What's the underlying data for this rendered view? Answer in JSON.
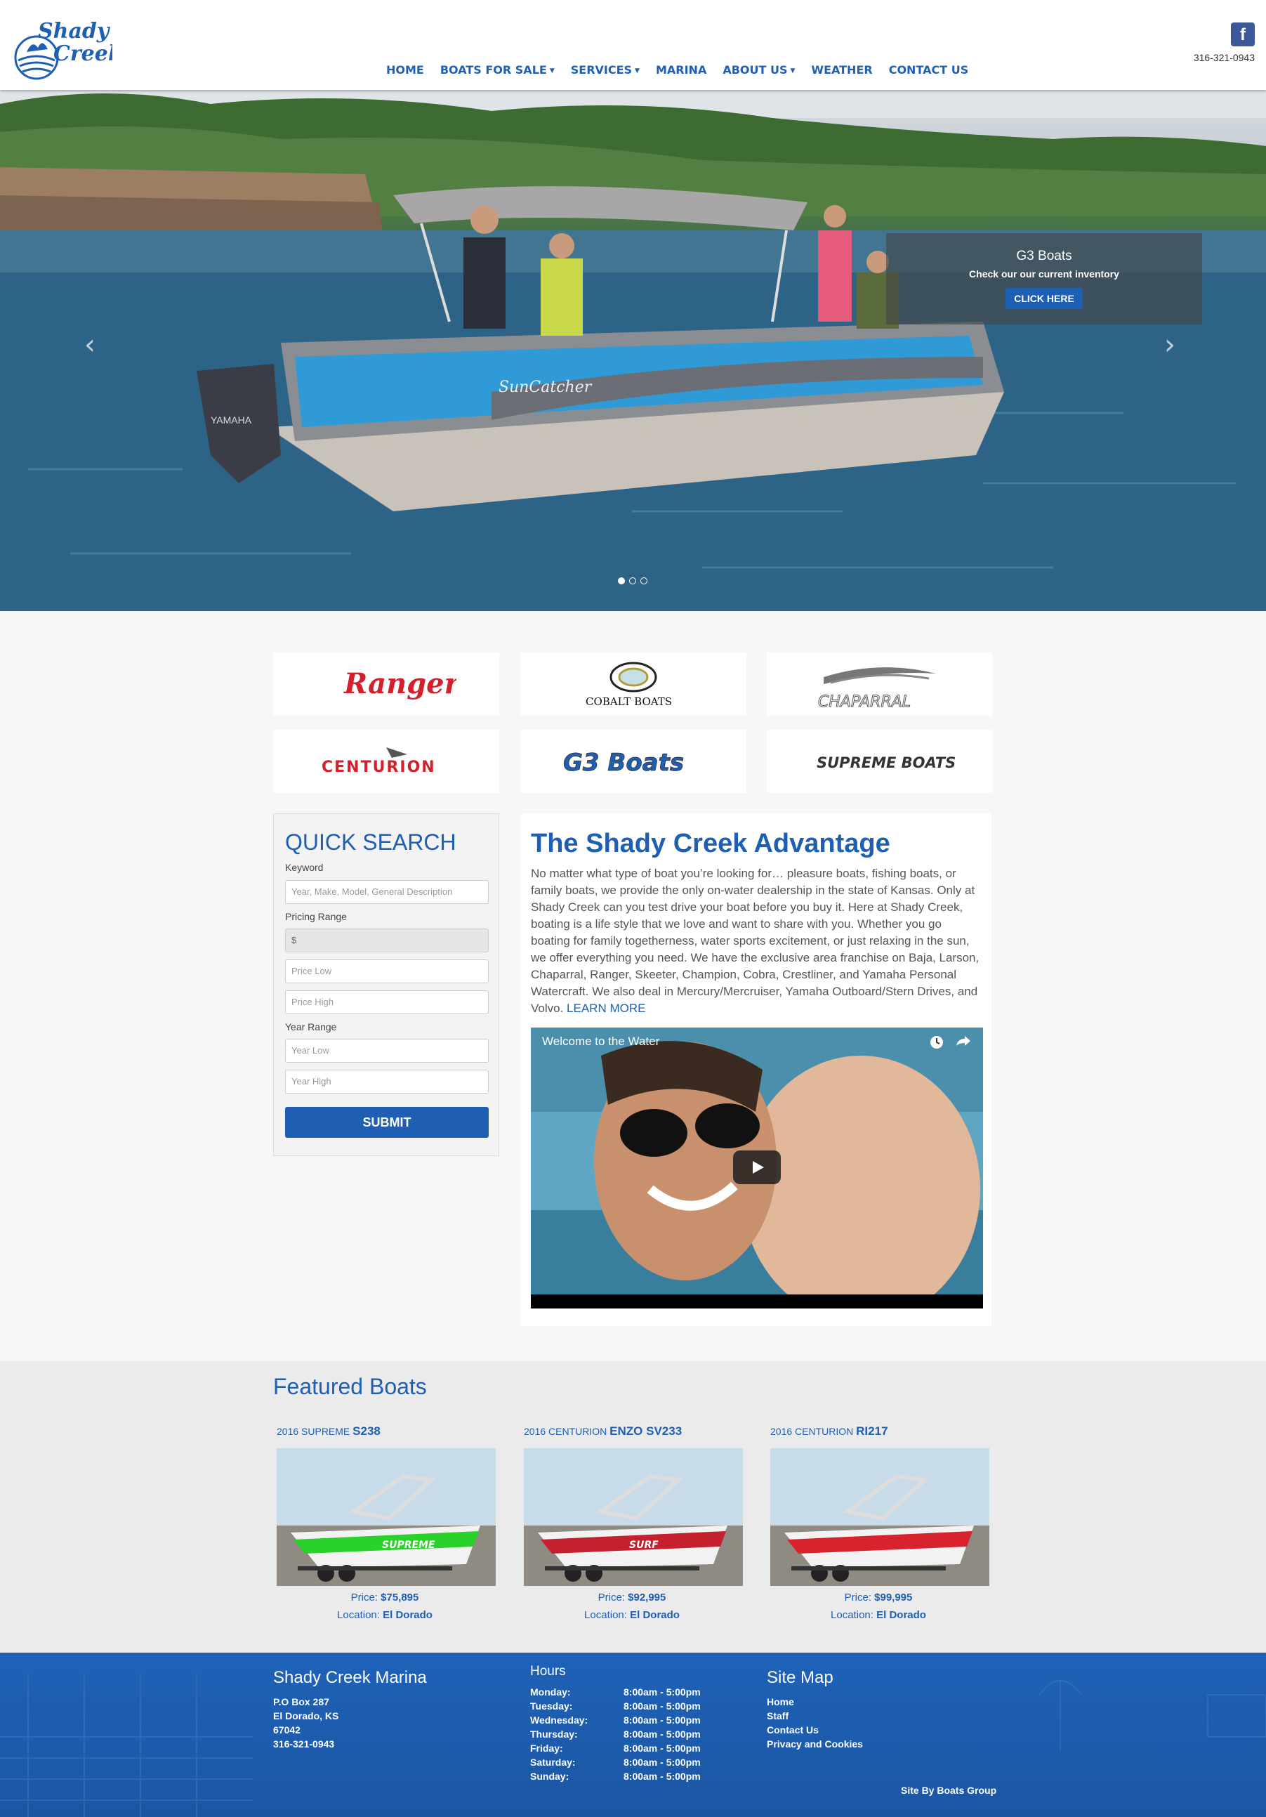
{
  "header": {
    "logo_text_top": "Shady",
    "logo_text_bottom": "Creek",
    "phone": "316-321-0943",
    "facebook_label": "f",
    "nav": [
      {
        "label": "HOME",
        "has_dropdown": false
      },
      {
        "label": "BOATS FOR SALE",
        "has_dropdown": true
      },
      {
        "label": "SERVICES",
        "has_dropdown": true
      },
      {
        "label": "MARINA",
        "has_dropdown": false
      },
      {
        "label": "ABOUT US",
        "has_dropdown": true
      },
      {
        "label": "WEATHER",
        "has_dropdown": false
      },
      {
        "label": "CONTACT US",
        "has_dropdown": false
      }
    ]
  },
  "hero": {
    "caption_title": "G3 Boats",
    "caption_subtitle": "Check our our current inventory",
    "caption_button": "CLICK HERE",
    "boat_name": "SunCatcher",
    "motor_label": "YAMAHA",
    "prev_icon": "‹",
    "next_icon": "›",
    "slides": 3,
    "active_slide": 1
  },
  "brands": [
    "Ranger",
    "COBALT BOATS",
    "CHAPARRAL",
    "CENTURION",
    "G3 Boats",
    "SUPREME BOATS"
  ],
  "quick_search": {
    "title": "QUICK SEARCH",
    "keyword_label": "Keyword",
    "keyword_placeholder": "Year, Make, Model, General Description",
    "pricing_label": "Pricing Range",
    "currency": "$",
    "price_low_placeholder": "Price Low",
    "price_high_placeholder": "Price High",
    "year_label": "Year Range",
    "year_low_placeholder": "Year Low",
    "year_high_placeholder": "Year High",
    "submit_label": "SUBMIT"
  },
  "advantage": {
    "title": "The Shady Creek Advantage",
    "body": "No matter what type of boat you’re looking for… pleasure boats, fishing boats, or family boats, we provide the only on-water dealership in the state of Kansas. Only at Shady Creek can you test drive your boat before you buy it. Here at Shady Creek, boating is a life style that we love and want to share with you. Whether you go boating for family togetherness, water sports excitement, or just relaxing in the sun, we offer everything you need. We have the exclusive area franchise on Baja, Larson, Chaparral, Ranger, Skeeter, Champion, Cobra, Crestliner, and Yamaha Personal Watercraft. We also deal in Mercury/Mercruiser, Yamaha Outboard/Stern Drives, and Volvo.",
    "learn_more": "LEARN MORE",
    "video_title": "Welcome to the Water"
  },
  "featured": {
    "title": "Featured Boats",
    "boats": [
      {
        "prefix": "2016 SUPREME",
        "model": "S238",
        "price_label": "Price:",
        "price": "$75,895",
        "location_label": "Location:",
        "location": "El Dorado",
        "hull": "#2bd12b",
        "decal": "SUPREME"
      },
      {
        "prefix": "2016 CENTURION",
        "model": "ENZO SV233",
        "price_label": "Price:",
        "price": "$92,995",
        "location_label": "Location:",
        "location": "El Dorado",
        "hull": "#c4202e",
        "decal": "SURF"
      },
      {
        "prefix": "2016 CENTURION",
        "model": "RI217",
        "price_label": "Price:",
        "price": "$99,995",
        "location_label": "Location:",
        "location": "El Dorado",
        "hull": "#d8222e",
        "decal": ""
      }
    ]
  },
  "footer": {
    "marina_title": "Shady Creek Marina",
    "address": [
      "P.O Box 287",
      "El Dorado, KS",
      "67042",
      "316-321-0943"
    ],
    "hours_title": "Hours",
    "hours": [
      {
        "day": "Monday:",
        "time": "8:00am - 5:00pm"
      },
      {
        "day": "Tuesday:",
        "time": "8:00am - 5:00pm"
      },
      {
        "day": "Wednesday:",
        "time": "8:00am - 5:00pm"
      },
      {
        "day": "Thursday:",
        "time": "8:00am - 5:00pm"
      },
      {
        "day": "Friday:",
        "time": "8:00am - 5:00pm"
      },
      {
        "day": "Saturday:",
        "time": "8:00am - 5:00pm"
      },
      {
        "day": "Sunday:",
        "time": "8:00am - 5:00pm"
      }
    ],
    "sitemap_title": "Site Map",
    "sitemap": [
      "Home",
      "Staff",
      "Contact Us",
      "Privacy and Cookies"
    ],
    "credit": "Site By Boats Group"
  },
  "colors": {
    "brand_blue": "#1e5fb4",
    "facebook": "#3b5998",
    "footer_blue": "#1f62b8"
  }
}
